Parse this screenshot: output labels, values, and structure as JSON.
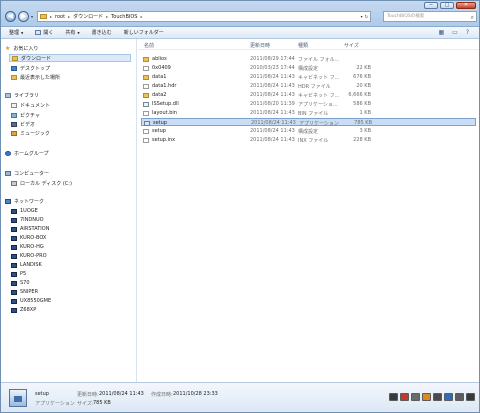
{
  "window": {
    "controls": {
      "minimize": "─",
      "maximize": "□",
      "close": "✕"
    },
    "back_glyph": "◀",
    "forward_glyph": "▶",
    "dropdown_glyph": "▾"
  },
  "address": {
    "separator": "▸",
    "crumbs": [
      "root",
      "ダウンロード",
      "TouchBIOS"
    ],
    "dropdown_glyph": "▾",
    "refresh_glyph": "↻"
  },
  "search": {
    "placeholder": "TouchBIOSの検索",
    "icon": "search-icon"
  },
  "toolbar": {
    "organize": "整理",
    "open": "開く",
    "share": "共有",
    "burn": "書き込む",
    "new_folder": "新しいフォルダー",
    "view_glyph": "▦",
    "preview_glyph": "▭",
    "help_glyph": "?"
  },
  "nav": {
    "favorites": {
      "label": "お気に入り",
      "items": [
        "ダウンロード",
        "デスクトップ",
        "最近表示した場所"
      ]
    },
    "libraries": {
      "label": "ライブラリ",
      "items": [
        "ドキュメント",
        "ピクチャ",
        "ビデオ",
        "ミュージック"
      ]
    },
    "homegroup": {
      "label": "ホームグループ"
    },
    "computer": {
      "label": "コンピューター",
      "items": [
        "ローカル ディスク (C:)"
      ]
    },
    "network": {
      "label": "ネットワーク",
      "items": [
        "1UOGE",
        "7INDNUO",
        "AIRSTATION",
        "KURO-BOX",
        "KURO-HG",
        "KURO-PRO",
        "LANDISK",
        "P5",
        "S70",
        "SNIPER",
        "UX8550GME",
        "Z68XP"
      ]
    }
  },
  "columns": {
    "name": "名前",
    "date": "更新日時",
    "type": "種類",
    "size": "サイズ"
  },
  "files": [
    {
      "name": "ablios",
      "date": "2011/08/29 17:44",
      "type": "ファイル フォル...",
      "size": "",
      "icon": "folder-icon"
    },
    {
      "name": "0x0409",
      "date": "2010/03/23 17:44",
      "type": "構成設定",
      "size": "22 KB",
      "icon": "settings-file-icon"
    },
    {
      "name": "data1",
      "date": "2011/08/24 11:43",
      "type": "キャビネット フ...",
      "size": "676 KB",
      "icon": "cabinet-icon"
    },
    {
      "name": "data1.hdr",
      "date": "2011/08/24 11:43",
      "type": "HDR ファイル",
      "size": "20 KB",
      "icon": "file-icon"
    },
    {
      "name": "data2",
      "date": "2011/08/24 11:43",
      "type": "キャビネット フ...",
      "size": "6,666 KB",
      "icon": "cabinet-icon"
    },
    {
      "name": "ISSetup.dll",
      "date": "2011/08/20 11:39",
      "type": "アプリケーショ...",
      "size": "586 KB",
      "icon": "dll-icon"
    },
    {
      "name": "layout.bin",
      "date": "2011/08/24 11:43",
      "type": "BIN ファイル",
      "size": "1 KB",
      "icon": "file-icon"
    },
    {
      "name": "setup",
      "date": "2011/08/24 11:43",
      "type": "アプリケーション",
      "size": "785 KB",
      "icon": "setup-exe-icon",
      "selected": true
    },
    {
      "name": "setup",
      "date": "2011/08/24 11:43",
      "type": "構成設定",
      "size": "3 KB",
      "icon": "settings-file-icon"
    },
    {
      "name": "setup.inx",
      "date": "2011/08/24 11:43",
      "type": "INX ファイル",
      "size": "228 KB",
      "icon": "file-icon"
    }
  ],
  "details": {
    "name": "setup",
    "modified_label": "更新日時:",
    "modified": "2011/08/24 11:43",
    "created_label": "作成日時:",
    "created": "2011/10/28 23:33",
    "type": "アプリケーション",
    "size_label": "サイズ:",
    "size": "785 KB"
  },
  "colors": {
    "selection": "#c9def5",
    "accent": "#3b6fb0"
  }
}
